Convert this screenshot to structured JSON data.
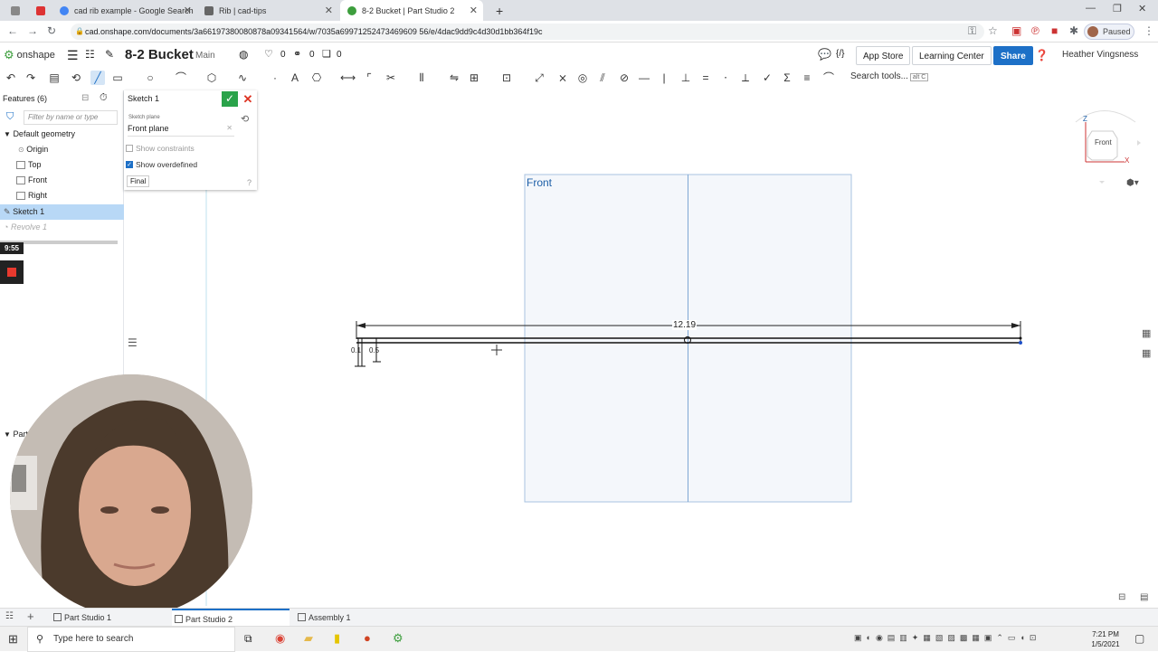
{
  "browser": {
    "tabs": [
      {
        "title": "cad rib example - Google Search",
        "active": false
      },
      {
        "title": "Rib | cad-tips",
        "active": false
      },
      {
        "title": "8-2 Bucket | Part Studio 2",
        "active": true
      }
    ],
    "url": "cad.onshape.com/documents/3a66197380080878a09341564/w/7035a69971252473469609 56/e/4dac9dd9c4d30d1bb364f19c",
    "profile_status": "Paused"
  },
  "app": {
    "logo_text": "onshape",
    "doc_name": "8-2 Bucket",
    "branch": "Main",
    "likes": "0",
    "links": "0",
    "versions": "0",
    "app_store": "App Store",
    "learning_center": "Learning Center",
    "share": "Share",
    "user": "Heather Vingsness",
    "search_tools": "Search tools...",
    "search_shortcut": "alt C"
  },
  "features": {
    "header": "Features (6)",
    "filter_placeholder": "Filter by name or type",
    "group": "Default geometry",
    "items": [
      {
        "label": "Origin"
      },
      {
        "label": "Top"
      },
      {
        "label": "Front"
      },
      {
        "label": "Right"
      },
      {
        "label": "Sketch 1",
        "selected": true
      },
      {
        "label": "Revolve 1",
        "suppressed": true
      }
    ],
    "parts_label": "Part"
  },
  "recorder": {
    "time": "9:55"
  },
  "sketch_dialog": {
    "title": "Sketch 1",
    "plane_label": "Sketch plane",
    "plane_value": "Front plane",
    "show_constraints": "Show constraints",
    "show_constraints_checked": false,
    "show_overdefined": "Show overdefined",
    "show_overdefined_checked": true,
    "final": "Final"
  },
  "viewport": {
    "plane_label": "Front",
    "dim_width": "12.19",
    "dim_height": "0.5",
    "dim_small": "0.1"
  },
  "viewcube": {
    "face": "Front",
    "axis_z": "Z",
    "axis_x": "X"
  },
  "bottom_tabs": [
    {
      "label": "Part Studio 1",
      "active": false
    },
    {
      "label": "Part Studio 2",
      "active": true
    },
    {
      "label": "Assembly 1",
      "active": false
    }
  ],
  "taskbar": {
    "search": "Type here to search",
    "time": "7:21 PM",
    "date": "1/5/2021"
  },
  "colors": {
    "accent": "#1d70c7",
    "confirm": "#2aa34a",
    "selection": "#b8d8f6",
    "plane_fill": "#f3f6fa",
    "plane_stroke": "#a9c3e0"
  }
}
